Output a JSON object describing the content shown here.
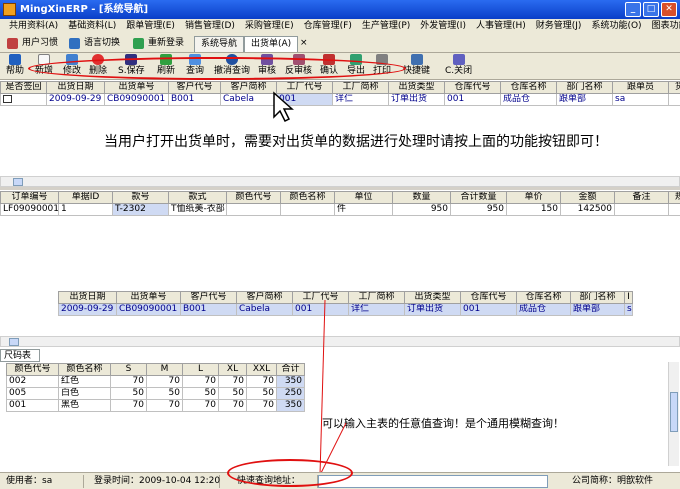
{
  "window": {
    "title": "MingXinERP - [系统导航]"
  },
  "menu": [
    "共用资料(A)",
    "基础资料(L)",
    "跟单管理(E)",
    "销售管理(D)",
    "采购管理(E)",
    "仓库管理(F)",
    "生产管理(P)",
    "外发管理(I)",
    "人事管理(H)",
    "财务管理(J)",
    "系统功能(O)",
    "图表功能"
  ],
  "quickbar": {
    "habit": "用户习惯",
    "lang": "语言切换",
    "relogin": "重新登录"
  },
  "doc_tabs": {
    "nav": "系统导航",
    "delivery": "出货单(A)"
  },
  "toolbar": [
    "帮助",
    "新增",
    "修改",
    "删除",
    "S.保存",
    "刷新",
    "查询",
    "撤消查询",
    "审核",
    "反审核",
    "确认",
    "导出",
    "打印",
    "快捷键",
    "C.关闭"
  ],
  "master": {
    "headers": [
      "是否签回",
      "出货日期",
      "出货单号",
      "客户代号",
      "客户简称",
      "工厂代号",
      "工厂简称",
      "出货类型",
      "仓库代号",
      "仓库名称",
      "部门名称",
      "跟单员",
      "货"
    ],
    "row": [
      "",
      "2009-09-29",
      "CB09090001",
      "B001",
      "Cabela",
      "001",
      "详仁",
      "订单出货",
      "001",
      "成品仓",
      "跟单部",
      "sa",
      ""
    ]
  },
  "annotation_top": "当用户打开出货单时，需要对出货单的数据进行处理时请按上面的功能按钮即可！",
  "detail": {
    "headers": [
      "订单编号",
      "单据ID",
      "款号",
      "款式",
      "颜色代号",
      "颜色名称",
      "单位",
      "数量",
      "合计数量",
      "单价",
      "金额",
      "备注",
      "规"
    ],
    "row": [
      "LF09090001",
      "1",
      "T-2302",
      "T恤纸美-衣部",
      "",
      "",
      "件",
      "950",
      "950",
      "150",
      "142500",
      "",
      ""
    ]
  },
  "query": {
    "headers": [
      "出货日期",
      "出货单号",
      "客户代号",
      "客户简称",
      "工厂代号",
      "工厂简称",
      "出货类型",
      "仓库代号",
      "仓库名称",
      "部门名称",
      "I"
    ],
    "row": [
      "2009-09-29",
      "CB09090001",
      "B001",
      "Cabela",
      "001",
      "详仁",
      "订单出货",
      "001",
      "成品仓",
      "跟单部",
      "sa"
    ]
  },
  "size_tab": "尺码表",
  "size": {
    "headers": [
      "颜色代号",
      "颜色名称",
      "S",
      "M",
      "L",
      "XL",
      "XXL",
      "合计"
    ],
    "rows": [
      [
        "002",
        "红色",
        "70",
        "70",
        "70",
        "70",
        "70",
        "350"
      ],
      [
        "005",
        "白色",
        "50",
        "50",
        "50",
        "50",
        "50",
        "250"
      ],
      [
        "001",
        "黑色",
        "70",
        "70",
        "70",
        "70",
        "70",
        "350"
      ]
    ]
  },
  "annotation_bottom": "可以输入主表的任意值查询！是个通用模糊查询！",
  "status": {
    "user": "使用者：sa",
    "login": "登录时间：2009-10-04 12:20",
    "quick": "快速查询地址：",
    "company": "公司简称：明歆软件"
  },
  "colors": {
    "title": "#0a3fc8",
    "chrome": "#ece9d8",
    "selected": "#cfdaf3",
    "annotation": "#e01010"
  }
}
